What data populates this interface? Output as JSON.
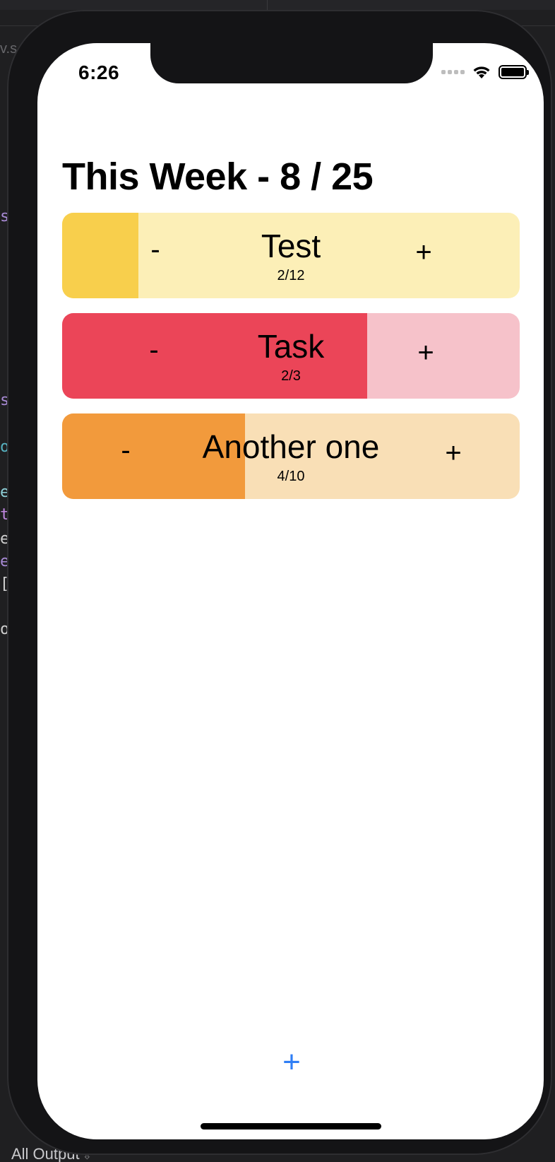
{
  "editor": {
    "crumb": "v.s",
    "bottom_label": "All Output",
    "gutter_chars": [
      "s",
      "s",
      "o",
      "e",
      "t",
      "e",
      "e",
      "[",
      "o"
    ],
    "gutter_colors": [
      "#a98bd6",
      "#a98bd6",
      "#57b3c2",
      "#8fd1d9",
      "#c087e0",
      "#cfcfcf",
      "#a98bd6",
      "#cfcfcf",
      "#cfcfcf"
    ]
  },
  "status_bar": {
    "time": "6:26"
  },
  "page": {
    "title": "This Week - 8 / 25"
  },
  "tasks": [
    {
      "name": "Test",
      "count": "2/12",
      "minus_label": "-",
      "plus_label": "+",
      "progress_fraction": 0.1667,
      "progress_color": "#f8cf4c",
      "background_color": "#fcefb7"
    },
    {
      "name": "Task",
      "count": "2/3",
      "minus_label": "-",
      "plus_label": "+",
      "progress_fraction": 0.6667,
      "progress_color": "#eb4558",
      "background_color": "#f6c2ca"
    },
    {
      "name": "Another one",
      "count": "4/10",
      "minus_label": "-",
      "plus_label": "+",
      "progress_fraction": 0.4,
      "progress_color": "#f29a3c",
      "background_color": "#f9dfb6"
    }
  ],
  "footer": {
    "add_label": "+"
  },
  "colors": {
    "accent": "#2f7ef5"
  }
}
